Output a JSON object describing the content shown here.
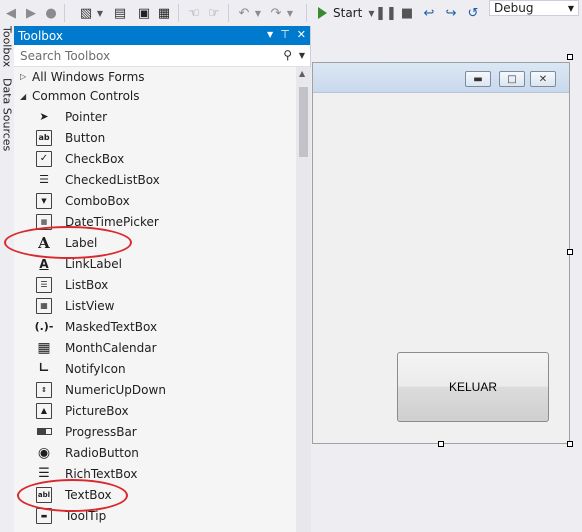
{
  "toolbar": {
    "start_label": "Start",
    "config_value": "Debug"
  },
  "side_tabs": [
    "Toolbox",
    "Data Sources"
  ],
  "toolbox": {
    "title": "Toolbox",
    "search_placeholder": "Search Toolbox",
    "groups": [
      {
        "label": "All Windows Forms",
        "expanded": false
      },
      {
        "label": "Common Controls",
        "expanded": true
      }
    ],
    "items": [
      {
        "label": "Pointer",
        "icon": "pointer-icon"
      },
      {
        "label": "Button",
        "icon": "button-icon"
      },
      {
        "label": "CheckBox",
        "icon": "checkbox-icon"
      },
      {
        "label": "CheckedListBox",
        "icon": "checkedlistbox-icon"
      },
      {
        "label": "ComboBox",
        "icon": "combobox-icon"
      },
      {
        "label": "DateTimePicker",
        "icon": "datetimepicker-icon"
      },
      {
        "label": "Label",
        "icon": "label-icon"
      },
      {
        "label": "LinkLabel",
        "icon": "linklabel-icon"
      },
      {
        "label": "ListBox",
        "icon": "listbox-icon"
      },
      {
        "label": "ListView",
        "icon": "listview-icon"
      },
      {
        "label": "MaskedTextBox",
        "icon": "maskedtextbox-icon"
      },
      {
        "label": "MonthCalendar",
        "icon": "monthcalendar-icon"
      },
      {
        "label": "NotifyIcon",
        "icon": "notifyicon-icon"
      },
      {
        "label": "NumericUpDown",
        "icon": "numericupdown-icon"
      },
      {
        "label": "PictureBox",
        "icon": "picturebox-icon"
      },
      {
        "label": "ProgressBar",
        "icon": "progressbar-icon"
      },
      {
        "label": "RadioButton",
        "icon": "radiobutton-icon"
      },
      {
        "label": "RichTextBox",
        "icon": "richtextbox-icon"
      },
      {
        "label": "TextBox",
        "icon": "textbox-icon"
      },
      {
        "label": "ToolTip",
        "icon": "tooltip-icon"
      }
    ]
  },
  "form": {
    "button_label": "KELUAR"
  },
  "colors": {
    "accent": "#007acc",
    "highlight": "#d9282e",
    "start_green": "#388a34"
  }
}
